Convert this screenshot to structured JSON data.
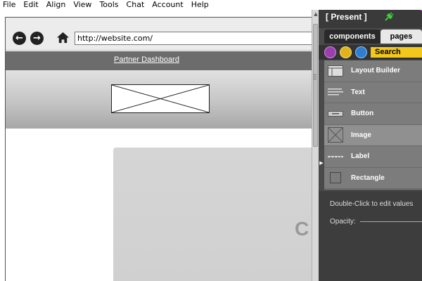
{
  "menu": [
    "File",
    "Edit",
    "Align",
    "View",
    "Tools",
    "Chat",
    "Account",
    "Help"
  ],
  "browser": {
    "back_icon": "arrow-left-circle",
    "forward_icon": "arrow-right-circle",
    "home_icon": "home",
    "url": "http://website.com/"
  },
  "dashboard": {
    "header_link": "Partner Dashboard",
    "partial_text": "C"
  },
  "panel": {
    "title": "[ Present ]",
    "tabs": [
      {
        "label": "components",
        "active": true
      },
      {
        "label": "pages",
        "active": false
      }
    ],
    "tool_icons": [
      "purple-tool-icon",
      "yellow-tool-icon",
      "blue-zoom-icon"
    ],
    "search_label": "Search",
    "components": [
      {
        "label": "Layout Builder",
        "icon": "layout-builder-icon"
      },
      {
        "label": "Text",
        "icon": "text-icon"
      },
      {
        "label": "Button",
        "icon": "button-icon"
      },
      {
        "label": "Image",
        "icon": "image-icon"
      },
      {
        "label": "Label",
        "icon": "label-icon"
      },
      {
        "label": "Rectangle",
        "icon": "rectangle-icon"
      }
    ],
    "hint": "Double-Click to edit values",
    "opacity_label": "Opacity:"
  },
  "colors": {
    "panel_bg": "#4a4a4a",
    "search_yellow": "#f2c81c",
    "header_gray": "#6c6c6c"
  }
}
